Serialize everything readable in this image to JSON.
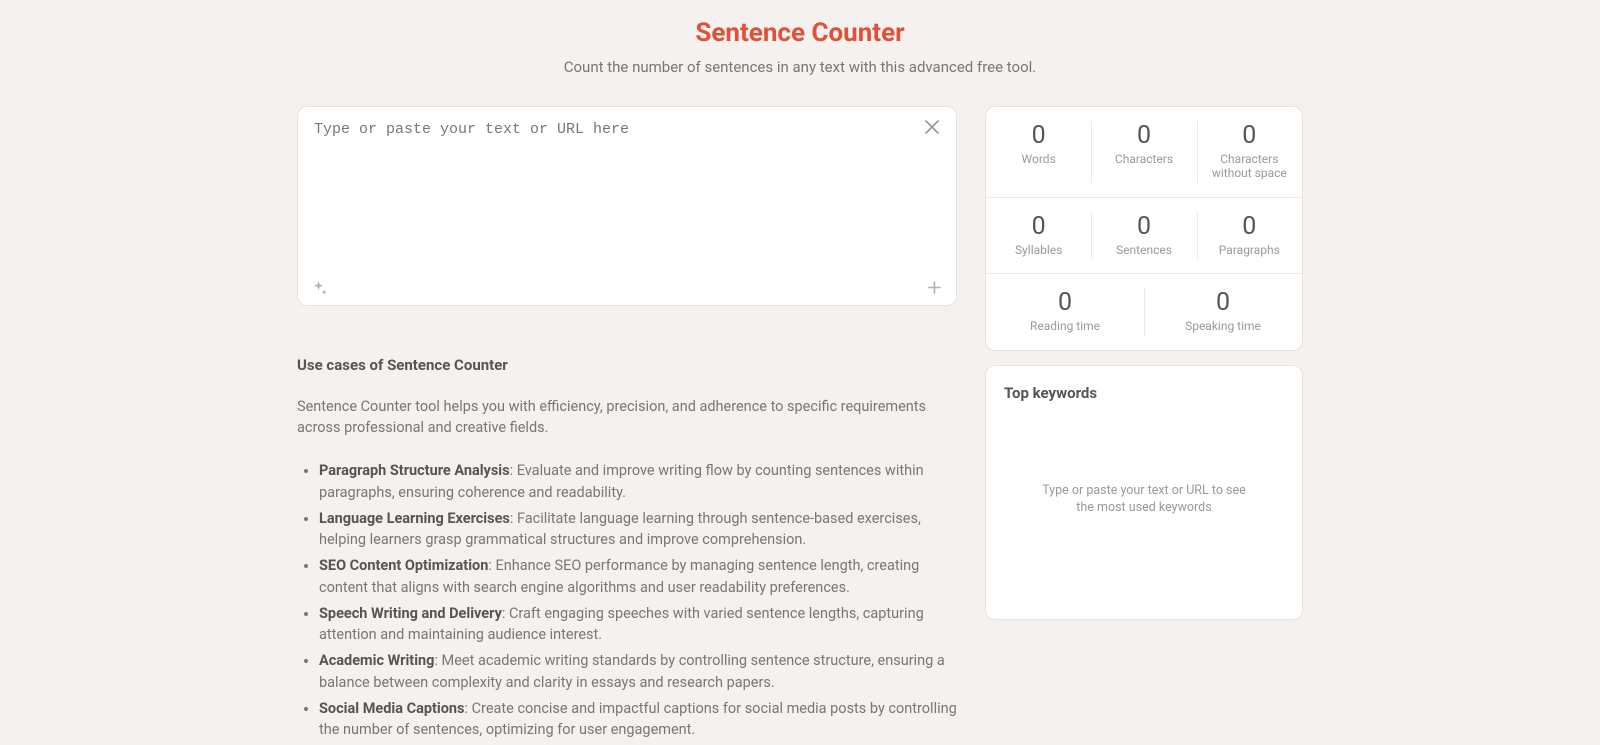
{
  "header": {
    "title": "Sentence Counter",
    "subtitle": "Count the number of sentences in any text with this advanced free tool."
  },
  "input": {
    "placeholder": "Type or paste your text or URL here",
    "value": ""
  },
  "stats": {
    "words": {
      "value": "0",
      "label": "Words"
    },
    "characters": {
      "value": "0",
      "label": "Characters"
    },
    "chars_no_sp": {
      "value": "0",
      "label": "Characters without space"
    },
    "syllables": {
      "value": "0",
      "label": "Syllables"
    },
    "sentences": {
      "value": "0",
      "label": "Sentences"
    },
    "paragraphs": {
      "value": "0",
      "label": "Paragraphs"
    },
    "reading_time": {
      "value": "0",
      "label": "Reading time"
    },
    "speaking_time": {
      "value": "0",
      "label": "Speaking time"
    }
  },
  "keywords": {
    "title": "Top keywords",
    "empty": "Type or paste your text or URL to see the most used keywords"
  },
  "content": {
    "heading": "Use cases of Sentence Counter",
    "intro": "Sentence Counter tool helps you with efficiency, precision, and adherence to specific requirements across professional and creative fields.",
    "items": [
      {
        "bold": "Paragraph Structure Analysis",
        "rest": ": Evaluate and improve writing flow by counting sentences within paragraphs, ensuring coherence and readability."
      },
      {
        "bold": "Language Learning Exercises",
        "rest": ": Facilitate language learning through sentence-based exercises, helping learners grasp grammatical structures and improve comprehension."
      },
      {
        "bold": "SEO Content Optimization",
        "rest": ": Enhance SEO performance by managing sentence length, creating content that aligns with search engine algorithms and user readability preferences."
      },
      {
        "bold": "Speech Writing and Delivery",
        "rest": ": Craft engaging speeches with varied sentence lengths, capturing attention and maintaining audience interest."
      },
      {
        "bold": "Academic Writing",
        "rest": ": Meet academic writing standards by controlling sentence structure, ensuring a balance between complexity and clarity in essays and research papers."
      },
      {
        "bold": "Social Media Captions",
        "rest": ": Create concise and impactful captions for social media posts by controlling the number of sentences, optimizing for user engagement."
      }
    ]
  }
}
